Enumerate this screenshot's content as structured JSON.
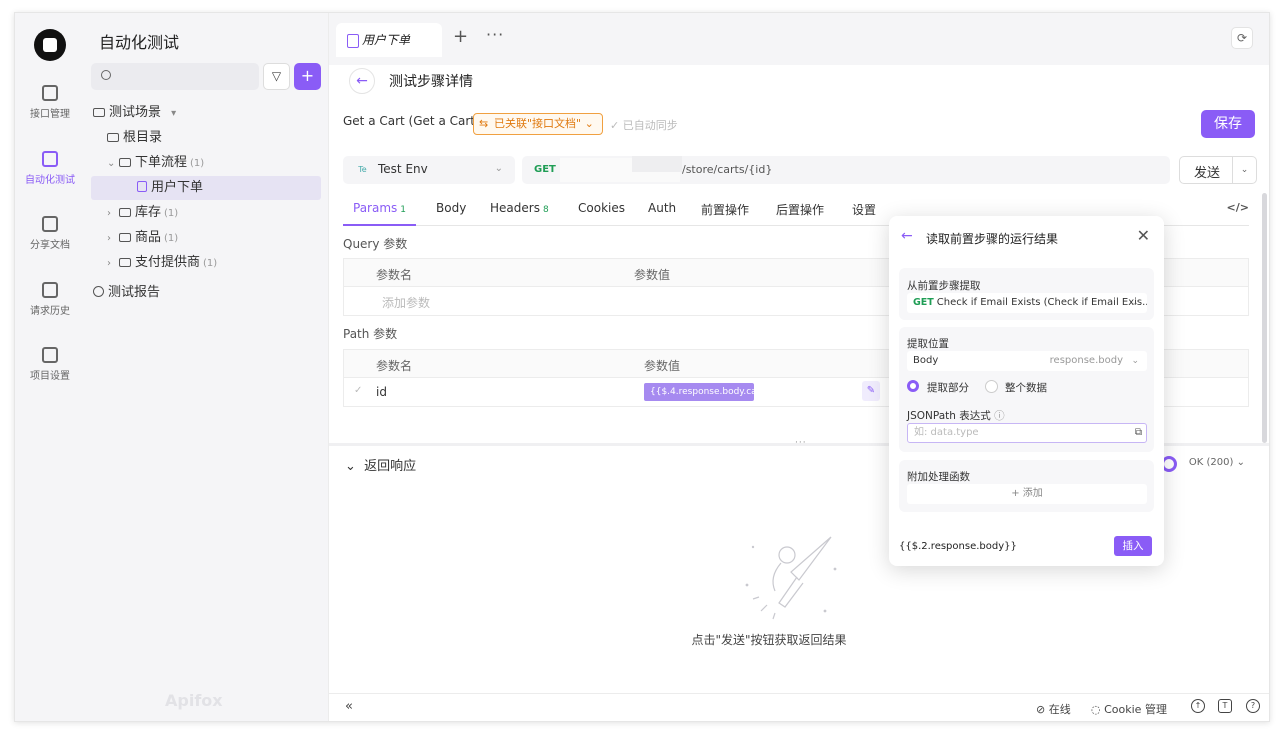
{
  "app": {
    "brand": "Apifox",
    "accent": "#8a5cf6"
  },
  "rail": {
    "items": [
      {
        "label": "接口管理",
        "icon": "api-management-icon"
      },
      {
        "label": "自动化测试",
        "icon": "automation-test-icon"
      },
      {
        "label": "分享文档",
        "icon": "share-docs-icon"
      },
      {
        "label": "请求历史",
        "icon": "request-history-icon"
      },
      {
        "label": "项目设置",
        "icon": "project-settings-icon"
      }
    ]
  },
  "sidebar": {
    "title": "自动化测试",
    "search_placeholder": "",
    "tree": {
      "scenes": "测试场景",
      "root": "根目录",
      "order_flow": "下单流程",
      "order_flow_count": "(1)",
      "place_order": "用户下单",
      "inventory": "库存",
      "inventory_count": "(1)",
      "goods": "商品",
      "goods_count": "(1)",
      "payment": "支付提供商",
      "payment_count": "(1)",
      "reports": "测试报告"
    }
  },
  "tabs": {
    "active": "用户下单",
    "plus": "+",
    "more": "···"
  },
  "page": {
    "title": "测试步骤详情",
    "back": "←"
  },
  "step": {
    "name": "Get a Cart (Get a Cart)",
    "linked": "已关联\"接口文档\"",
    "auto_sync": "已自动同步",
    "save": "保存"
  },
  "request": {
    "env_tag": "Te",
    "env": "Test Env",
    "method": "GET",
    "url_tail": "/store/carts/{id}",
    "send": "发送"
  },
  "req_tabs": {
    "params": "Params",
    "params_count": "1",
    "body": "Body",
    "headers": "Headers",
    "headers_count": "8",
    "cookies": "Cookies",
    "auth": "Auth",
    "pre": "前置操作",
    "post": "后置操作",
    "settings": "设置"
  },
  "query": {
    "label": "Query 参数",
    "col_name": "参数名",
    "col_value": "参数值",
    "add_placeholder": "添加参数"
  },
  "path": {
    "label": "Path 参数",
    "col_name": "参数名",
    "col_value": "参数值",
    "row_name": "id",
    "row_value": "{{$.4.response.body.ca..."
  },
  "response": {
    "label": "返回响应",
    "status": "OK (200)",
    "empty_hint": "点击\"发送\"按钮获取返回结果"
  },
  "footer": {
    "online": "在线",
    "cookie": "Cookie 管理"
  },
  "popover": {
    "title": "读取前置步骤的运行结果",
    "from_label": "从前置步骤提取",
    "from_method": "GET",
    "from_value": "Check if Email Exists (Check if Email Exis...",
    "pos_label": "提取位置",
    "pos_value": "Body",
    "pos_right": "response.body",
    "radio_part": "提取部分",
    "radio_all": "整个数据",
    "jsonpath_label": "JSONPath 表达式",
    "jsonpath_placeholder": "如: data.type",
    "fn_label": "附加处理函数",
    "fn_add": "+ 添加",
    "expr": "{{$.2.response.body}}",
    "insert": "插入"
  }
}
